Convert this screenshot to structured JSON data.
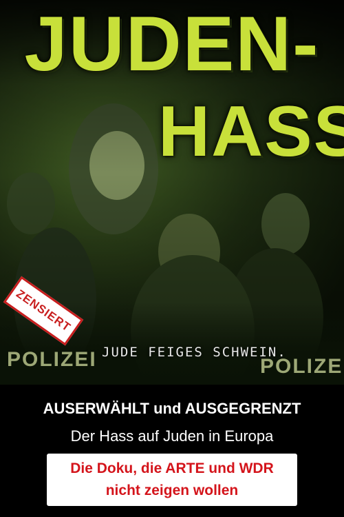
{
  "poster": {
    "title_line1": "JUDEN-",
    "title_line2": "HASS",
    "scene_caption": "JUDE FEIGES SCHWEIN.",
    "police_left": "POLIZEI",
    "police_right": "POLIZEI",
    "stamp": "ZENSIERT",
    "headline": "AUSERWÄHLT und AUSGEGRENZT",
    "subheadline": "Der Hass auf Juden in Europa",
    "tagline_line1": "Die Doku, die ARTE und WDR",
    "tagline_line2": "nicht zeigen wollen"
  },
  "colors": {
    "title_green": "#c8e03a",
    "stamp_red": "#c81e1e",
    "tagline_red": "#d4141b",
    "background": "#000000"
  }
}
